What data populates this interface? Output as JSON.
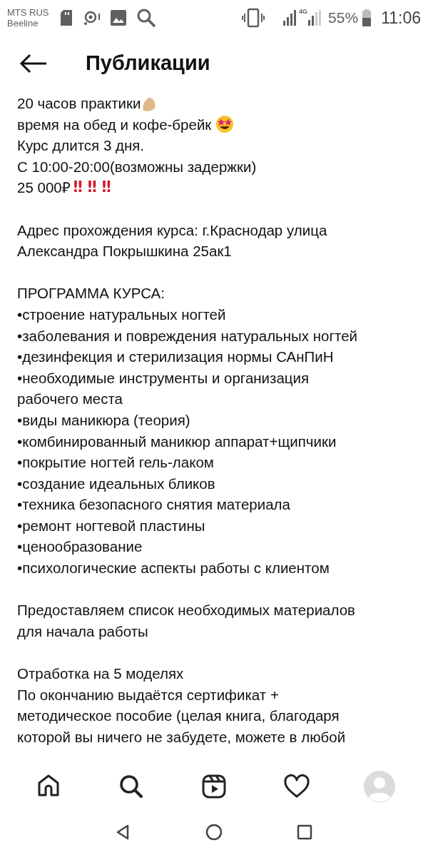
{
  "status_bar": {
    "carrier_1": "MTS RUS",
    "carrier_2": "Beeline",
    "network": "4G",
    "battery": "55%",
    "time": "11:06"
  },
  "header": {
    "title": "Публикации"
  },
  "post_text": [
    {
      "lines": [
        {
          "text": "20 часов практики",
          "kind": "clap"
        },
        {
          "text": "время на обед и кофе-брейк ",
          "kind": "starry"
        },
        {
          "text": "Курс длится 3 дня."
        },
        {
          "text": "С 10:00-20:00(возможны задержки)"
        },
        {
          "text": "25 000₽",
          "marks": "‼ ‼ ‼"
        }
      ]
    },
    {
      "lines": [
        {
          "text": "Адрес прохождения курса: г.Краснодар улица"
        },
        {
          "text": "Александра Покрышкина 25ак1"
        }
      ]
    },
    {
      "lines": [
        {
          "text": "ПРОГРАММА КУРСА:"
        },
        {
          "text": "•строение натуральных ногтей"
        },
        {
          "text": "•заболевания и повреждения натуральных ногтей"
        },
        {
          "text": "•дезинфекция и стерилизация нормы САнПиН"
        },
        {
          "text": "•необходимые инструменты и организация"
        },
        {
          "text": "рабочего места"
        },
        {
          "text": "•виды маникюра (теория)"
        },
        {
          "text": "•комбинированный маникюр аппарат+щипчики"
        },
        {
          "text": "•покрытие ногтей гель-лаком"
        },
        {
          "text": "•создание идеальных бликов"
        },
        {
          "text": "•техника безопасного снятия материала"
        },
        {
          "text": "•ремонт ногтевой пластины"
        },
        {
          "text": "•ценообразование"
        },
        {
          "text": "•психологические аспекты работы с клиентом"
        }
      ]
    },
    {
      "lines": [
        {
          "text": "Предоставляем список необходимых материалов"
        },
        {
          "text": "для начала работы"
        }
      ]
    },
    {
      "lines": [
        {
          "text": "Отработка на 5 моделях"
        },
        {
          "text": "По окончанию выдаётся сертификат +"
        },
        {
          "text": "методическое пособие (целая книга, благодаря"
        },
        {
          "text": "которой вы ничего не забудете, можете в любой"
        }
      ]
    }
  ],
  "bottom_tabs": [
    {
      "kind": "home"
    },
    {
      "kind": "search"
    },
    {
      "kind": "reels"
    },
    {
      "kind": "activity"
    },
    {
      "kind": "profile"
    }
  ],
  "system_nav": [
    {
      "kind": "back"
    },
    {
      "kind": "home"
    },
    {
      "kind": "recents"
    }
  ]
}
